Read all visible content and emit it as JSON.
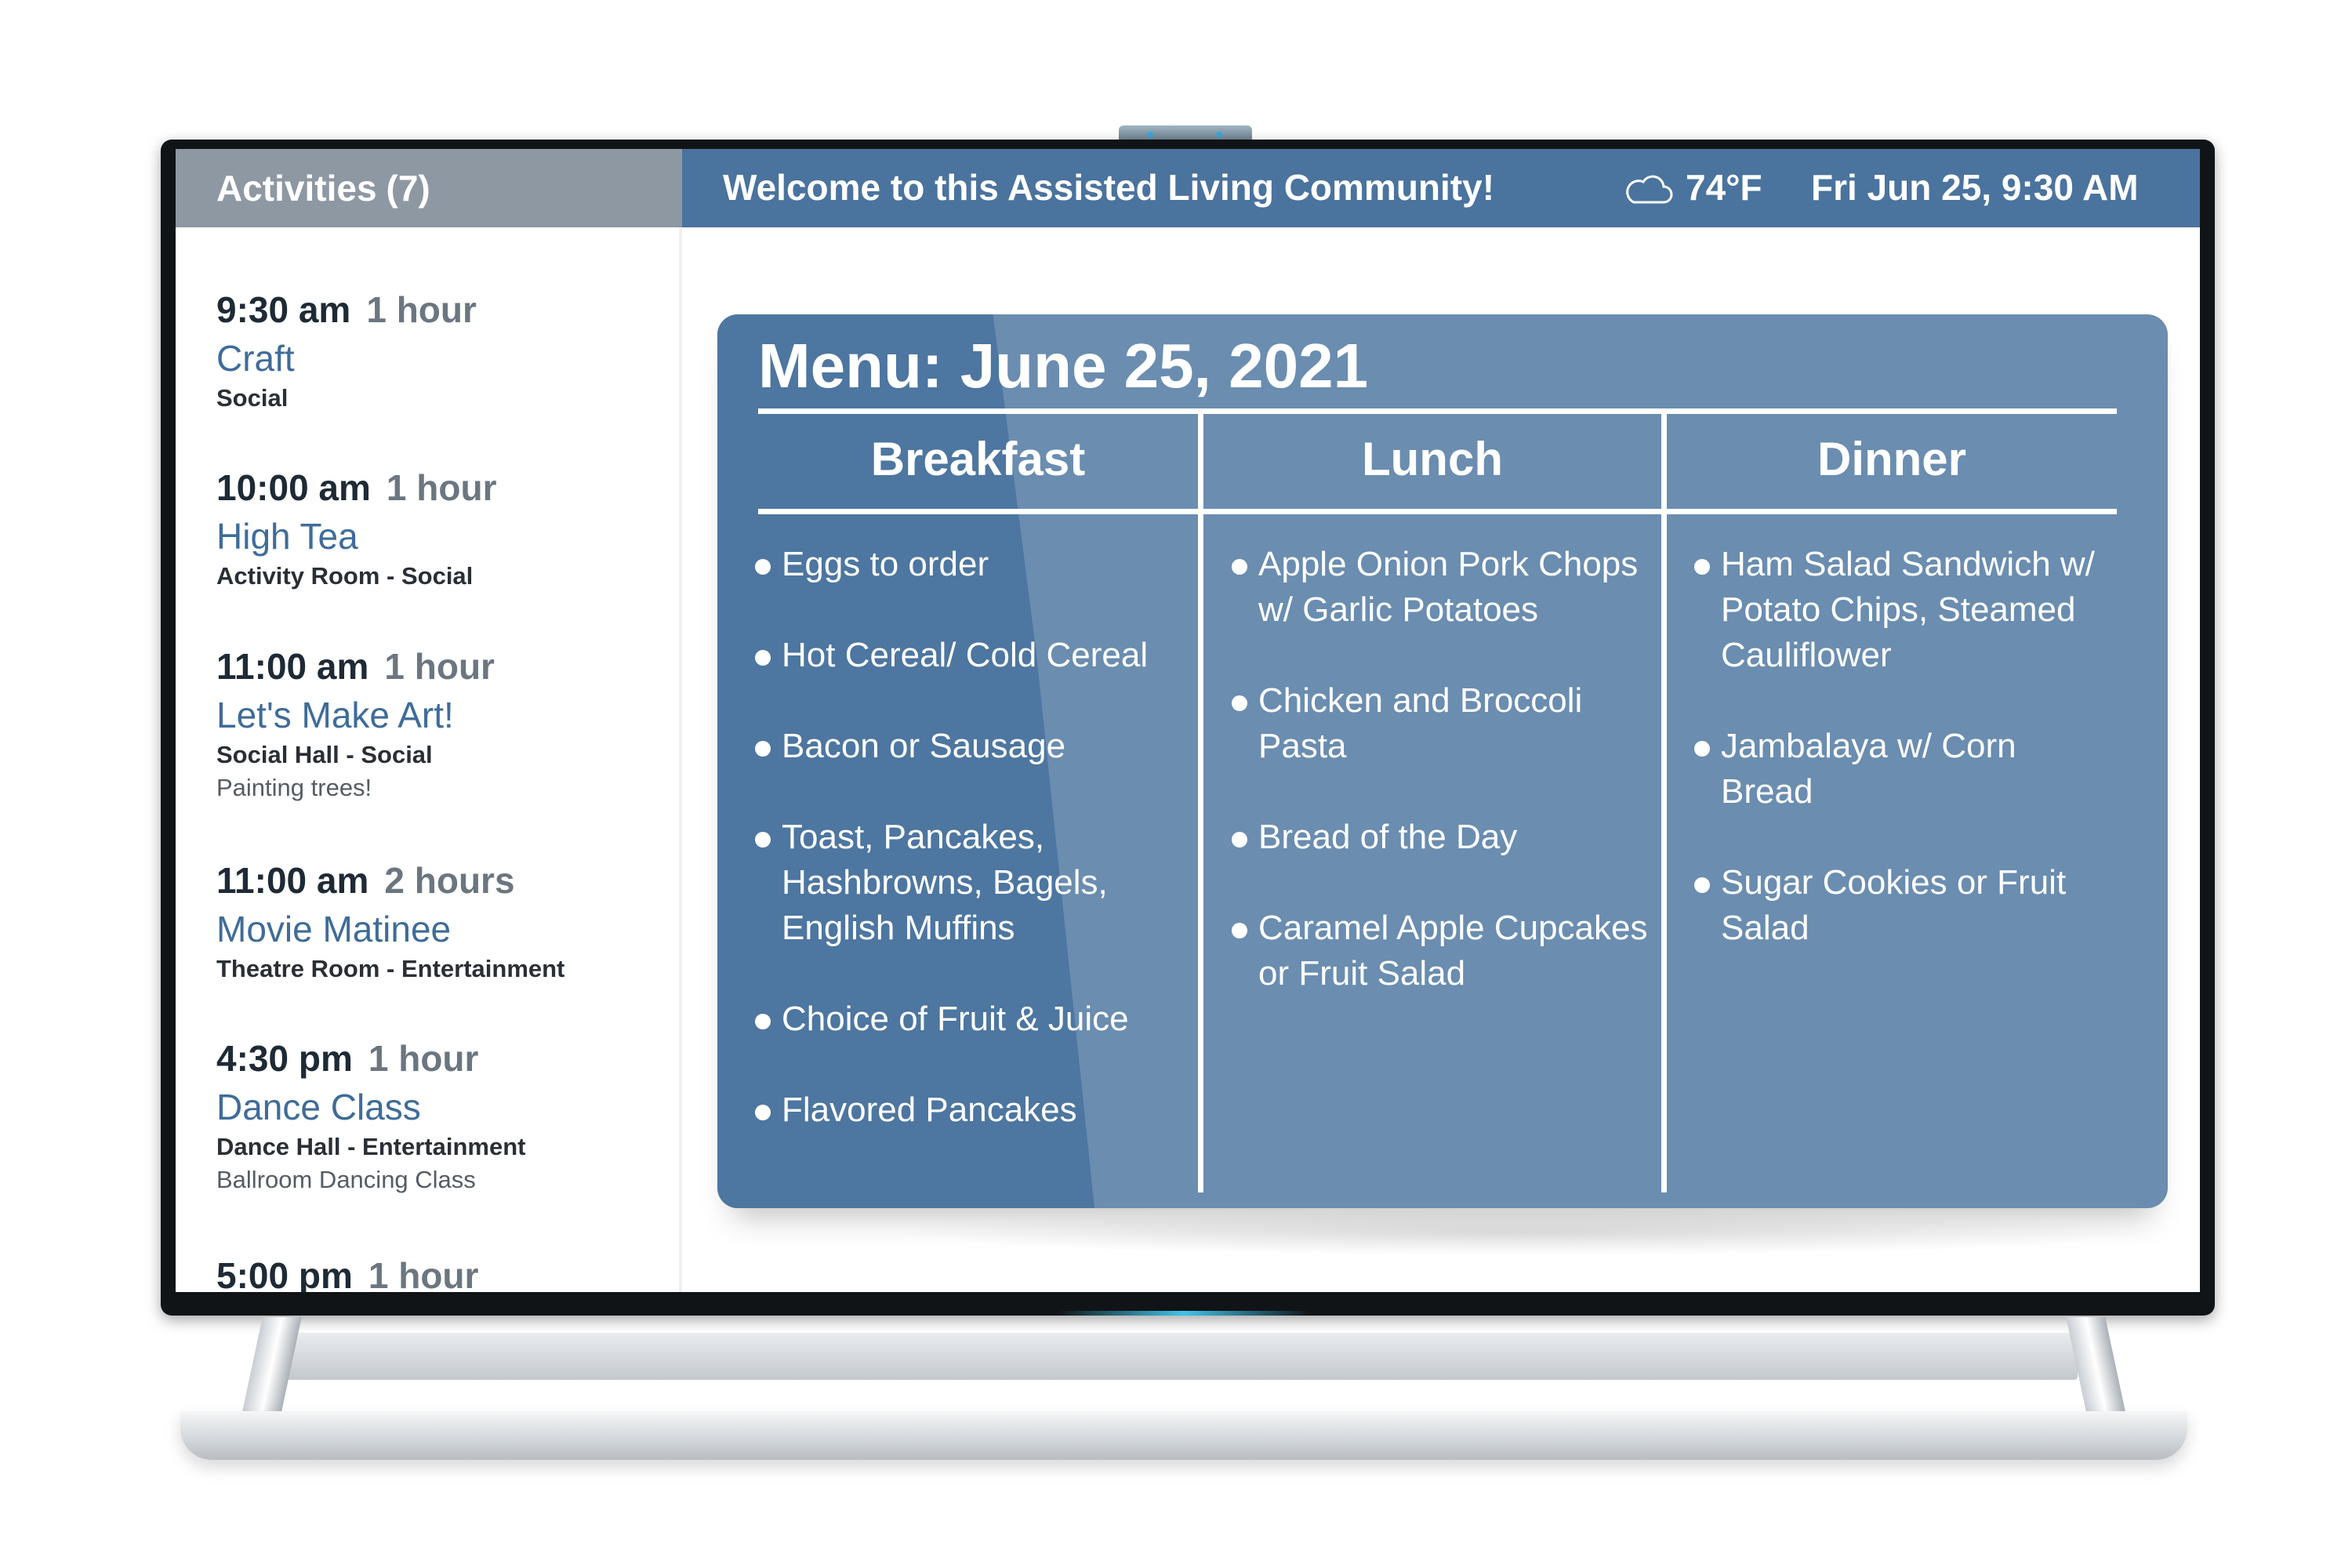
{
  "activities": {
    "header": "Activities",
    "count": "(7)",
    "items": [
      {
        "time": "9:30 am",
        "duration": "1 hour",
        "title": "Craft",
        "location": "Social",
        "description": ""
      },
      {
        "time": "10:00 am",
        "duration": "1 hour",
        "title": "High Tea",
        "location": "Activity Room - Social",
        "description": ""
      },
      {
        "time": "11:00 am",
        "duration": "1 hour",
        "title": "Let's Make Art!",
        "location": "Social Hall - Social",
        "description": "Painting trees!"
      },
      {
        "time": "11:00 am",
        "duration": "2 hours",
        "title": "Movie Matinee",
        "location": "Theatre Room - Entertainment",
        "description": ""
      },
      {
        "time": "4:30 pm",
        "duration": "1 hour",
        "title": "Dance Class",
        "location": "Dance Hall - Entertainment",
        "description": "Ballroom Dancing Class"
      },
      {
        "time": "5:00 pm",
        "duration": "1 hour",
        "title": "",
        "location": "",
        "description": ""
      }
    ]
  },
  "header": {
    "welcome": "Welcome to this Assisted Living Community!",
    "weather_icon": "cloud-icon",
    "temperature": "74°F",
    "datetime": "Fri Jun 25, 9:30 AM"
  },
  "menu": {
    "title": "Menu: June 25, 2021",
    "columns": [
      {
        "heading": "Breakfast",
        "items": [
          "Eggs to order",
          "Hot Cereal/ Cold Cereal",
          "Bacon or Sausage",
          "Toast, Pancakes, Hashbrowns, Bagels, English Muffins",
          "Choice of Fruit & Juice",
          "Flavored Pancakes"
        ]
      },
      {
        "heading": "Lunch",
        "items": [
          "Apple Onion Pork Chops w/ Garlic Potatoes",
          "Chicken and Broccoli Pasta",
          "Bread of the Day",
          "Caramel Apple Cupcakes or Fruit Salad"
        ]
      },
      {
        "heading": "Dinner",
        "items": [
          "Ham Salad Sandwich w/ Potato Chips, Steamed Cauliflower",
          "Jambalaya w/ Corn Bread",
          "Sugar Cookies or Fruit Salad"
        ]
      }
    ]
  },
  "colors": {
    "header_bar": "#4a739e",
    "activities_header": "#8e98a3",
    "menu_card": "#6a8db0",
    "activity_title": "#3f6c99"
  }
}
